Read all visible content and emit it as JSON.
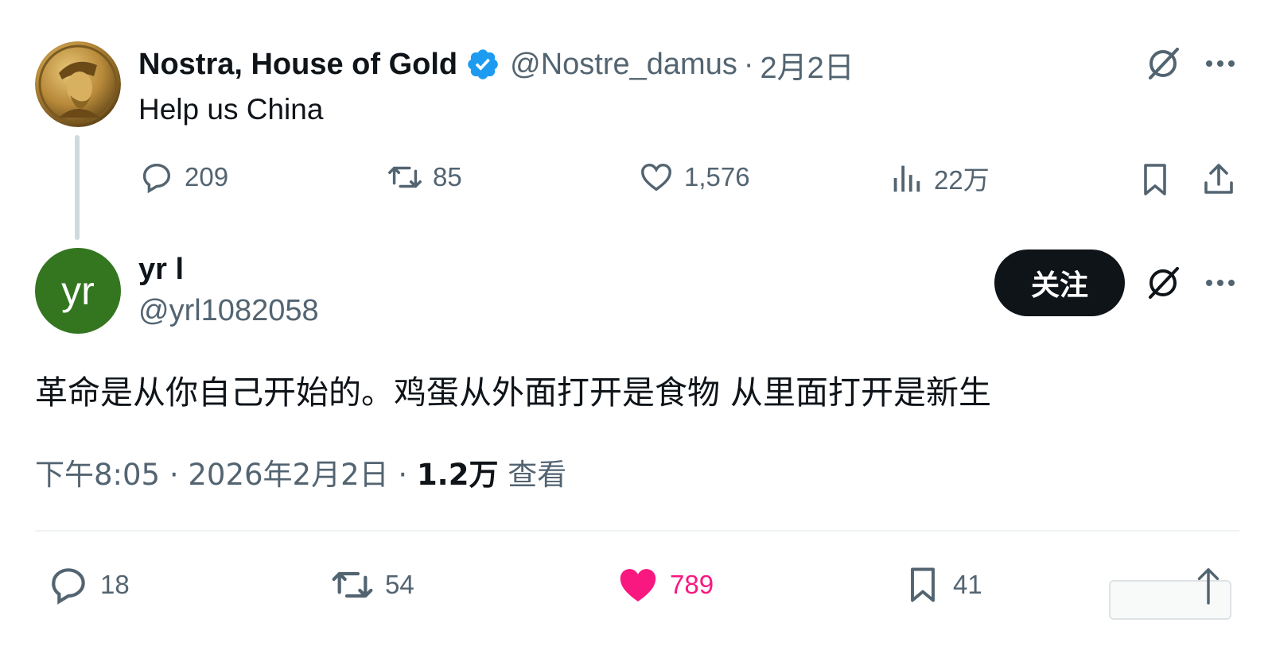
{
  "parent_tweet": {
    "name": "Nostra, House of Gold",
    "handle": "@Nostre_damus",
    "separator": "·",
    "date": "2月2日",
    "text": "Help us China",
    "replies": "209",
    "reposts": "85",
    "likes": "1,576",
    "views": "22万",
    "icons": [
      "grok-icon",
      "more-icon",
      "reply-icon",
      "repost-icon",
      "like-icon",
      "views-icon",
      "bookmark-icon",
      "share-icon"
    ]
  },
  "reply_tweet": {
    "avatar_initials": "yr",
    "avatar_color": "#33761f",
    "name": "yr l",
    "handle": "@yrl1082058",
    "follow_label": "关注",
    "text": "革命是从你自己开始的。鸡蛋从外面打开是食物 从里面打开是新生",
    "time": "下午8:05",
    "date": "2026年2月2日",
    "separator": "·",
    "views_count": "1.2万",
    "views_label": "查看",
    "replies": "18",
    "reposts": "54",
    "likes": "789",
    "bookmarks": "41",
    "liked": true
  },
  "colors": {
    "text_primary": "#0f1419",
    "text_secondary": "#536471",
    "verified_blue": "#1d9bf0",
    "like_pink": "#f91880",
    "thread_line": "#cfd9de"
  }
}
